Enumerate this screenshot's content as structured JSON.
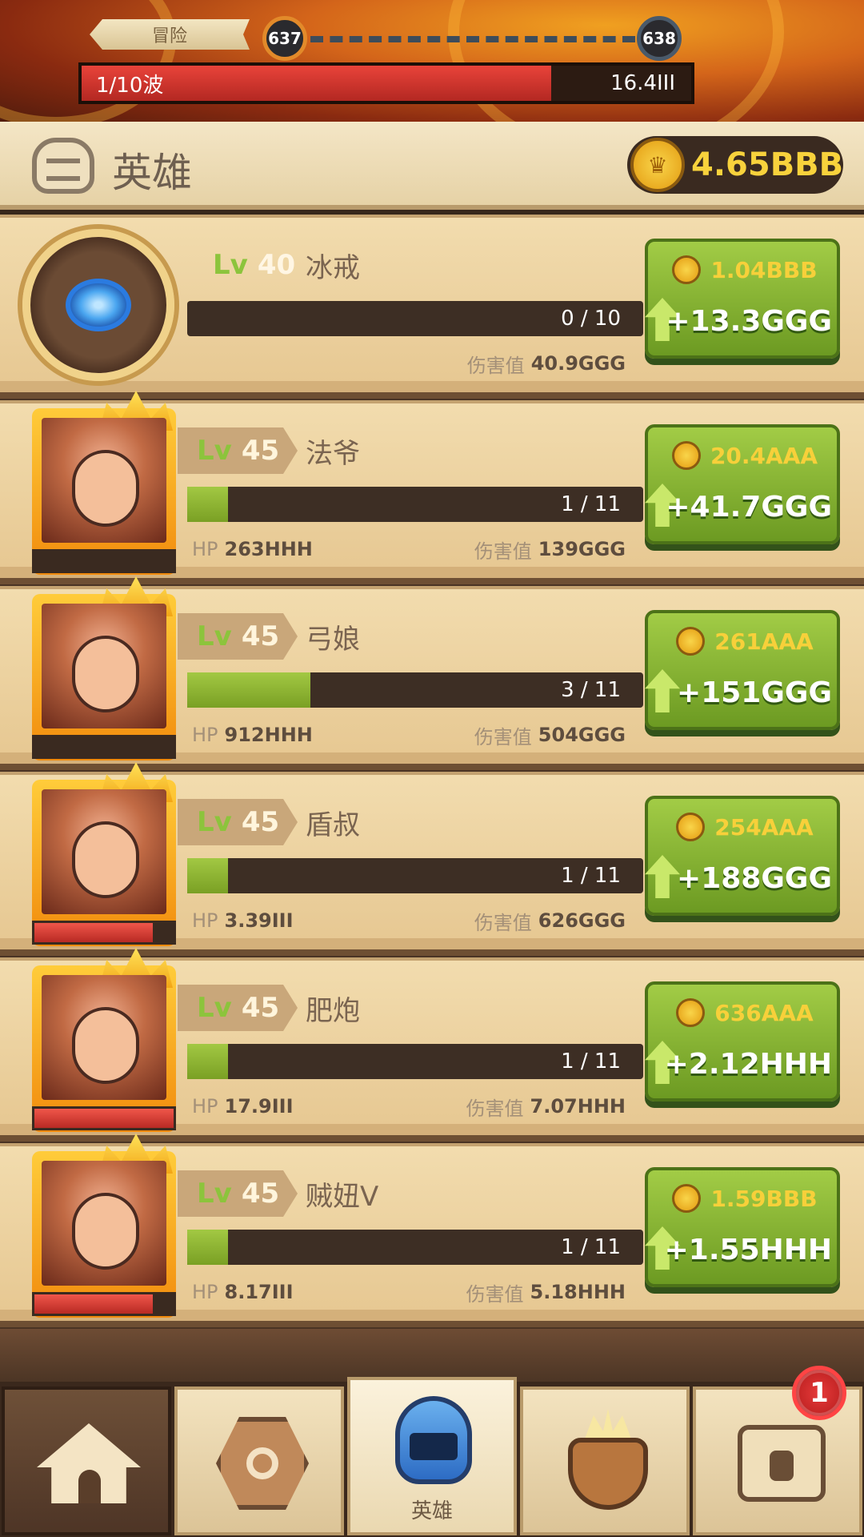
{
  "battle": {
    "stage_label": "冒险",
    "current_stage": "637",
    "next_stage": "638",
    "wave_label": "1/10波",
    "wave_hp": "16.4III",
    "wave_hp_fraction": 0.77
  },
  "header": {
    "title": "英雄",
    "gold": "4.65BBB"
  },
  "heroes": [
    {
      "lv_label": "Lv",
      "level": "40",
      "name": "冰戒",
      "progress": "0 / 10",
      "progress_fraction": 0.0,
      "hp_label": "",
      "hp": "",
      "dmg_label": "伤害值",
      "dmg": "40.9GGG",
      "cost": "1.04BBB",
      "gain": "+13.3GGG",
      "portrait_icon": "blue-ring-icon"
    },
    {
      "lv_label": "Lv",
      "level": "45",
      "name": "法爷",
      "progress": "1 / 11",
      "progress_fraction": 0.09,
      "hp_label": "HP",
      "hp": "263HHH",
      "hp_fraction": 0.0,
      "dmg_label": "伤害值",
      "dmg": "139GGG",
      "cost": "20.4AAA",
      "gain": "+41.7GGG",
      "portrait_icon": "wizard-portrait-icon"
    },
    {
      "lv_label": "Lv",
      "level": "45",
      "name": "弓娘",
      "progress": "3 / 11",
      "progress_fraction": 0.27,
      "hp_label": "HP",
      "hp": "912HHH",
      "hp_fraction": 0.0,
      "dmg_label": "伤害值",
      "dmg": "504GGG",
      "cost": "261AAA",
      "gain": "+151GGG",
      "portrait_icon": "archer-portrait-icon"
    },
    {
      "lv_label": "Lv",
      "level": "45",
      "name": "盾叔",
      "progress": "1 / 11",
      "progress_fraction": 0.09,
      "hp_label": "HP",
      "hp": "3.39III",
      "hp_fraction": 0.85,
      "dmg_label": "伤害值",
      "dmg": "626GGG",
      "cost": "254AAA",
      "gain": "+188GGG",
      "portrait_icon": "shield-uncle-portrait-icon"
    },
    {
      "lv_label": "Lv",
      "level": "45",
      "name": "肥炮",
      "progress": "1 / 11",
      "progress_fraction": 0.09,
      "hp_label": "HP",
      "hp": "17.9III",
      "hp_fraction": 1.0,
      "dmg_label": "伤害值",
      "dmg": "7.07HHH",
      "cost": "636AAA",
      "gain": "+2.12HHH",
      "portrait_icon": "cannoneer-portrait-icon"
    },
    {
      "lv_label": "Lv",
      "level": "45",
      "name": "贼妞V",
      "progress": "1 / 11",
      "progress_fraction": 0.09,
      "hp_label": "HP",
      "hp": "8.17III",
      "hp_fraction": 0.85,
      "dmg_label": "伤害值",
      "dmg": "5.18HHH",
      "cost": "1.59BBB",
      "gain": "+1.55HHH",
      "portrait_icon": "thief-girl-portrait-icon"
    }
  ],
  "nav": {
    "tabs": [
      {
        "icon": "tent-icon",
        "label": ""
      },
      {
        "icon": "rune-stone-icon",
        "label": ""
      },
      {
        "icon": "helmet-icon",
        "label": "英雄"
      },
      {
        "icon": "cauldron-icon",
        "label": ""
      },
      {
        "icon": "treasure-chest-icon",
        "label": ""
      }
    ],
    "chest_badge": "1"
  },
  "colors": {
    "accent_green": "#8cc43c",
    "gold_text": "#f8d23c",
    "hp_red": "#e9433a"
  }
}
